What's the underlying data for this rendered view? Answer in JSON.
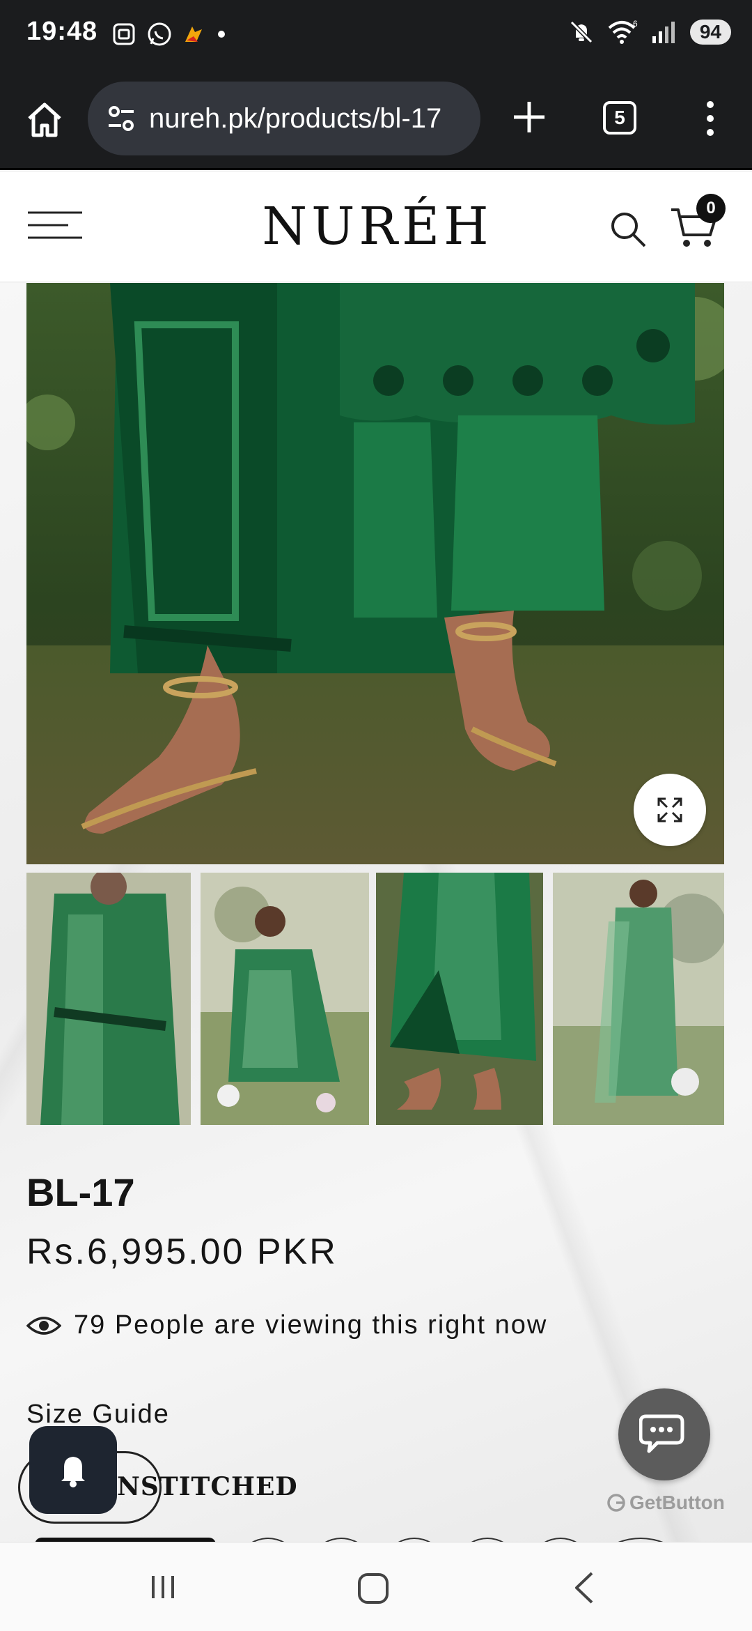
{
  "status_bar": {
    "time": "19:48",
    "battery": "94",
    "icons": [
      "screenshot-icon",
      "whatsapp-icon",
      "app-icon",
      "dot-icon",
      "mute-icon",
      "wifi-icon",
      "signal-icon"
    ]
  },
  "browser": {
    "url": "nureh.pk/products/bl-17",
    "tab_count": "5"
  },
  "site": {
    "logo": "NURÉH",
    "cart_count": "0"
  },
  "product": {
    "title": "BL-17",
    "price": "Rs.6,995.00 PKR",
    "viewers": "79 People are viewing this right now",
    "size_guide": "Size Guide",
    "variant_label": "NSTITCHED"
  },
  "chat_widget": {
    "brand": "GetButton"
  },
  "colors": {
    "dark_bar": "#1b1c1e",
    "url_bg": "#33363d",
    "accent_green": "#1f6b3c",
    "chat_bg": "#5c5c5c",
    "bell_bg": "#1e2530"
  }
}
